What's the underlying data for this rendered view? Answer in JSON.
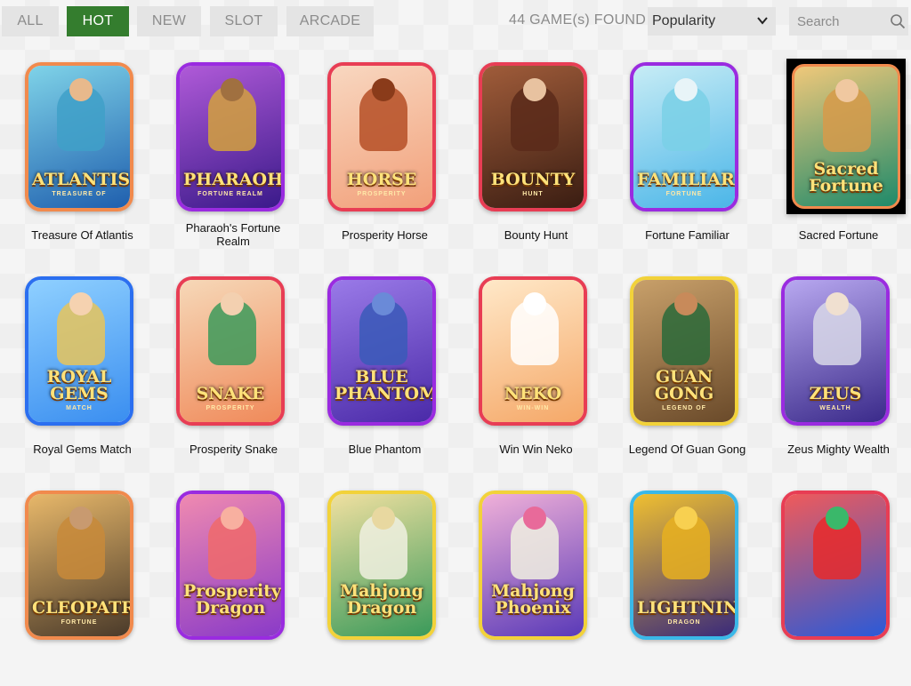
{
  "tabs": [
    {
      "label": "ALL",
      "active": false
    },
    {
      "label": "HOT",
      "active": true
    },
    {
      "label": "NEW",
      "active": false
    },
    {
      "label": "SLOT",
      "active": false
    },
    {
      "label": "ARCADE",
      "active": false
    }
  ],
  "results": {
    "count_text": "44 GAME(s) FOUND"
  },
  "sort": {
    "selected": "Popularity",
    "icon": "chevron-down-icon"
  },
  "search": {
    "placeholder": "Search",
    "value": "",
    "icon": "search-icon"
  },
  "games": [
    {
      "title": "Treasure Of Atlantis",
      "logo": "ATLANTIS",
      "sub": "TREASURE OF",
      "frame": "#f18a4d",
      "bg1": "#1f5fae",
      "bg2": "#7fd3e8",
      "fig": "#3fa0c8",
      "head": "#e8b98c"
    },
    {
      "title": "Pharaoh's Fortune Realm",
      "logo": "PHARAOH",
      "sub": "FORTUNE REALM",
      "frame": "#9a2be0",
      "bg1": "#3a1a8a",
      "bg2": "#b05ad8",
      "fig": "#d4a13c",
      "head": "#a07040"
    },
    {
      "title": "Prosperity Horse",
      "logo": "HORSE",
      "sub": "PROSPERITY",
      "frame": "#e83d54",
      "bg1": "#f2a07a",
      "bg2": "#f8d7c0",
      "fig": "#b54f26",
      "head": "#8a3b1a"
    },
    {
      "title": "Bounty Hunt",
      "logo": "BOUNTY",
      "sub": "HUNT",
      "frame": "#e83d54",
      "bg1": "#3a1d12",
      "bg2": "#a05c3a",
      "fig": "#5b2a1a",
      "head": "#e8c2a0"
    },
    {
      "title": "Fortune Familiar",
      "logo": "FAMILIAR",
      "sub": "FORTUNE",
      "frame": "#9a2be0",
      "bg1": "#4bb6e8",
      "bg2": "#c7ecf5",
      "fig": "#7ad0e6",
      "head": "#e8f4f8"
    },
    {
      "title": "Sacred Fortune",
      "logo": "Sacred Fortune",
      "sub": "",
      "frame": "#000000",
      "bg1": "#1e8a6a",
      "bg2": "#f0c87a",
      "fig": "#d79a4a",
      "head": "#f0c8a0"
    },
    {
      "title": "Royal Gems Match",
      "logo": "ROYAL GEMS",
      "sub": "MATCH",
      "frame": "#2b6ff0",
      "bg1": "#3a8ef0",
      "bg2": "#8fd0ff",
      "fig": "#e8c45a",
      "head": "#f5d2b0"
    },
    {
      "title": "Prosperity Snake",
      "logo": "SNAKE",
      "sub": "PROSPERITY",
      "frame": "#e83d54",
      "bg1": "#f08a5a",
      "bg2": "#f6d8b8",
      "fig": "#3c9a5a",
      "head": "#f3d0b0"
    },
    {
      "title": "Blue Phantom",
      "logo": "BLUE PHANTOM",
      "sub": "",
      "frame": "#9a2be0",
      "bg1": "#4a2aa8",
      "bg2": "#9a7ae8",
      "fig": "#3a5ab8",
      "head": "#6a8ad8"
    },
    {
      "title": "Win Win Neko",
      "logo": "NEKO",
      "sub": "WIN-WIN",
      "frame": "#e83d54",
      "bg1": "#f5a868",
      "bg2": "#ffe8c8",
      "fig": "#ffffff",
      "head": "#ffffff"
    },
    {
      "title": "Legend Of Guan Gong",
      "logo": "GUAN GONG",
      "sub": "LEGEND OF",
      "frame": "#f2d23a",
      "bg1": "#6a4a2a",
      "bg2": "#c8a06a",
      "fig": "#2a6a3a",
      "head": "#c88a5a"
    },
    {
      "title": "Zeus Mighty Wealth",
      "logo": "ZEUS",
      "sub": "WEALTH",
      "frame": "#9a2be0",
      "bg1": "#3a2a8a",
      "bg2": "#b8a8f0",
      "fig": "#d8d8e8",
      "head": "#f0e0d0"
    },
    {
      "title": "",
      "logo": "CLEOPATRA'S",
      "sub": "FORTUNE",
      "frame": "#f18a4d",
      "bg1": "#4a3a2a",
      "bg2": "#e8b86a",
      "fig": "#c88a3a",
      "head": "#c89a70"
    },
    {
      "title": "",
      "logo": "Prosperity Dragon",
      "sub": "",
      "frame": "#9a2be0",
      "bg1": "#8a3ac8",
      "bg2": "#f08ab0",
      "fig": "#f06a6a",
      "head": "#f8b0a0"
    },
    {
      "title": "",
      "logo": "Mahjong Dragon",
      "sub": "",
      "frame": "#f2d23a",
      "bg1": "#3a9a5a",
      "bg2": "#f0e0a0",
      "fig": "#f0f0e0",
      "head": "#e8d8a0"
    },
    {
      "title": "",
      "logo": "Mahjong Phoenix",
      "sub": "",
      "frame": "#f2d23a",
      "bg1": "#5a3ab8",
      "bg2": "#f0b0d8",
      "fig": "#f0f0e0",
      "head": "#e86a9a"
    },
    {
      "title": "",
      "logo": "LIGHTNING",
      "sub": "DRAGON",
      "frame": "#3ab8e8",
      "bg1": "#3a2a7a",
      "bg2": "#f0c030",
      "fig": "#e8b020",
      "head": "#f8d050"
    },
    {
      "title": "",
      "logo": "",
      "sub": "",
      "frame": "#e83d54",
      "bg1": "#2a5ad8",
      "bg2": "#f05a5a",
      "fig": "#e82a2a",
      "head": "#3ab86a"
    }
  ]
}
